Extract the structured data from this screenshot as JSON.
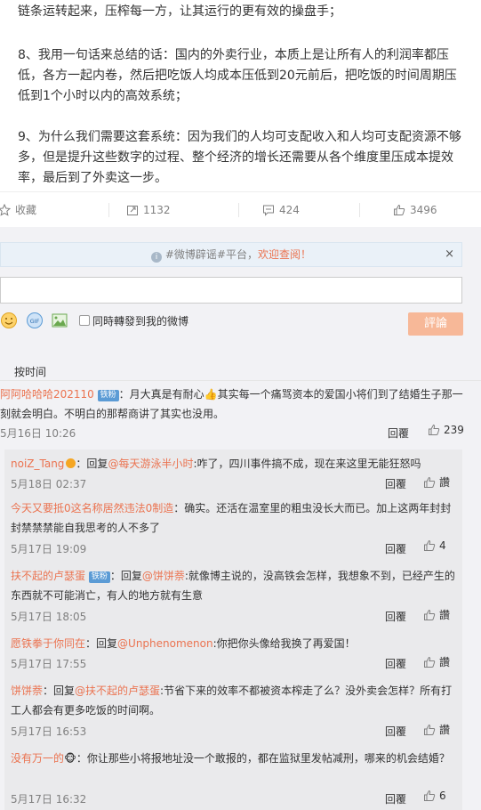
{
  "article": {
    "line_top": "链条运转起来，压榨每一方，让其运行的更有效的操盘手；",
    "p8": "8、我用一句话来总结的话：国内的外卖行业，本质上是让所有人的利润率都压低，各方一起内卷，然后把吃饭人均成本压低到20元前后，把吃饭的时间周期压低到1个小时以内的高效系统；",
    "p9": "9、为什么我们需要这套系统：因为我们的人均可支配收入和人均可支配资源不够多，但是提升这些数字的过程、整个经济的增长还需要从各个维度里压成本提效率，最后到了外卖这一步。"
  },
  "actions": {
    "favorite": "收藏",
    "repost": "1132",
    "comment": "424",
    "like": "3496"
  },
  "notice": {
    "text": "#微博辟谣#平台，",
    "highlight": "欢迎查阅！",
    "close": "×"
  },
  "composer": {
    "forward_label": "同時轉發到我的微博",
    "submit": "評論"
  },
  "sort_label": "按时间",
  "main_comment": {
    "user": "阿阿哈哈哈202110",
    "badge": "铁粉",
    "text": "：月大真是有耐心👍其实每一个痛骂资本的爱国小将们到了结婚生子那一刻就会明白。不明白的那帮商讲了其实也没用。",
    "time": "5月16日 10:26",
    "reply": "回覆",
    "likes": "239"
  },
  "sub_comments": [
    {
      "user": "noiZ_Tang",
      "verified": true,
      "prefix": "：回复",
      "mention": "@每天游泳半小时",
      "text": ":咋了，四川事件搞不成，现在来这里无能狂怒吗",
      "time": "5月18日 02:37",
      "reply": "回覆",
      "likes": "讚"
    },
    {
      "user": "今天又要抵0这名称居然违法0制造",
      "text": "：确实。还活在温室里的粗虫没长大而已。加上这两年封封封禁禁禁能自我思考的人不多了",
      "time": "5月17日 19:09",
      "reply": "回覆",
      "likes": "4"
    },
    {
      "user": "扶不起的卢瑟蛋",
      "badge": "铁粉",
      "prefix": "：回复",
      "mention": "@饼饼萘",
      "text": ":就像博主说的，没高铁会怎样，我想象不到，已经产生的东西就不可能消亡，有人的地方就有生意",
      "time": "5月17日 18:05",
      "reply": "回覆",
      "likes": "讚"
    },
    {
      "user": "愿铁拳于你同在",
      "prefix": "：回复",
      "mention": "@Unphenomenon",
      "text": ":你把你头像给我换了再爱国！",
      "time": "5月17日 17:55",
      "reply": "回覆",
      "likes": "讚"
    },
    {
      "user": "饼饼萘",
      "prefix": "：回复",
      "mention": "@扶不起的卢瑟蛋",
      "text": ":节省下来的效率不都被资本榨走了么？没外卖会怎样？所有打工人都会有更多吃饭的时间啊。",
      "time": "5月17日 16:53",
      "reply": "回覆",
      "likes": "讚"
    },
    {
      "user": "没有万一的",
      "emoji": "🐵",
      "text": "：你让那些小将报地址没一个敢报的，都在监狱里发帖减刑，哪来的机会结婚？",
      "time": "5月17日 16:32",
      "reply": "回覆",
      "likes": "6"
    }
  ]
}
